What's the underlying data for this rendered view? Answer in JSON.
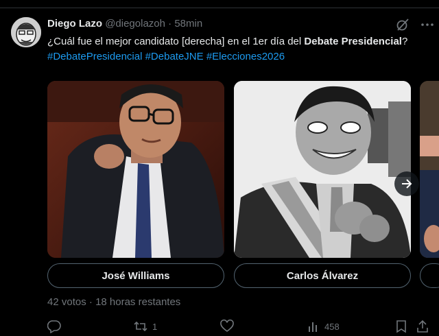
{
  "tweet": {
    "author_name": "Diego Lazo",
    "handle": "@diegolazoh",
    "separator": "·",
    "time": "58min",
    "text_part1": "¿Cuál fue el mejor candidato [derecha] en el 1er día del ",
    "text_bold": "Debate Presidencial",
    "text_part2": "? ",
    "hashtags": [
      "#DebatePresidencial",
      "#DebateJNE",
      "#Elecciones2026"
    ]
  },
  "poll": {
    "options": [
      {
        "label": "José Williams"
      },
      {
        "label": "Carlos Álvarez"
      }
    ],
    "votes": "42 votos",
    "separator": "·",
    "remaining": "18 horas restantes"
  },
  "actions": {
    "reply_count": "",
    "retweet_count": "1",
    "like_count": "",
    "views_count": "458"
  },
  "icons": {
    "grok": "grok-icon",
    "more": "more-icon",
    "next": "arrow-right-icon",
    "reply": "reply-icon",
    "retweet": "retweet-icon",
    "like": "heart-icon",
    "views": "views-icon",
    "bookmark": "bookmark-icon",
    "share": "share-icon"
  },
  "colors": {
    "background": "#000000",
    "text": "#e7e9ea",
    "secondary": "#71767b",
    "link": "#1d9bf0",
    "border": "#536471"
  }
}
